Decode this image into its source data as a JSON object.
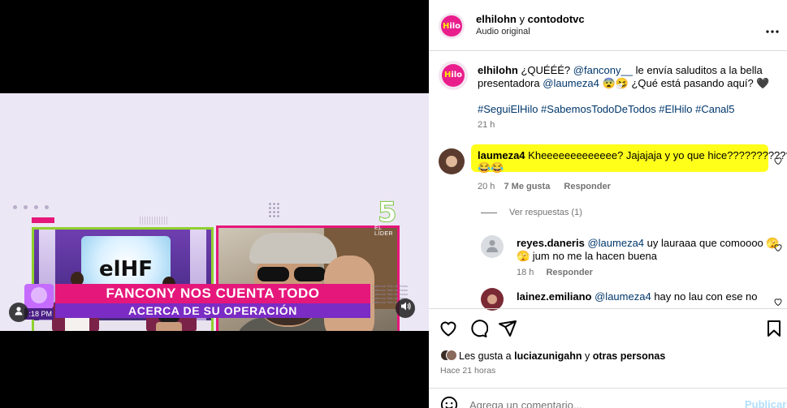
{
  "video": {
    "lower_third_line1": "FANCONY NOS CUENTA TODO",
    "lower_third_line2": "ACERCA DE SU OPERACIÓN",
    "time_label": ":18 PM",
    "channel_number": "5",
    "channel_sub": "EL LÍDER",
    "studio_logo_text": "elHF",
    "side_lines": [
      "Sabemos Todo de Todos",
      "Sabemos Todo de Todos",
      "Sabemos Todo de Todos",
      "Sabemos Todo de Todos",
      "Sabemos Todo de Todos"
    ]
  },
  "header": {
    "account": "elhilohn",
    "conj": "y",
    "collab": "contodotvc",
    "audio": "Audio original",
    "more_icon": "more-horizontal-icon"
  },
  "caption": {
    "username": "elhilohn",
    "text_a": "¿QUÉÉÉ?",
    "mention_1": "@fancony__",
    "text_b": "le envía saluditos a la bella",
    "text_c": "presentadora",
    "mention_2": "@laumeza4",
    "text_d": "😨🤧 ¿Qué está pasando aquí? 🖤",
    "hashtags": "#SeguiElHilo #SabemosTodoDeTodos #ElHilo #Canal5",
    "time": "21 h"
  },
  "comments": [
    {
      "username": "laumeza4",
      "text_line1": "Kheeeeeeeeeeeee? Jajajaja y yo que hice???????????",
      "text_line2": "😂😂",
      "time": "20 h",
      "likes": "7 Me gusta",
      "reply": "Responder",
      "view_replies": "Ver respuestas (1)"
    },
    {
      "username": "reyes.daneris",
      "mention": "@laumeza4",
      "text_line1": "uy lauraaa que comoooo 🫣",
      "text_line2": "🫣 jum no me la hacen buena",
      "time": "18 h",
      "reply": "Responder"
    },
    {
      "username": "lainez.emiliano",
      "mention": "@laumeza4",
      "text_line1": "hay no lau con ese no"
    }
  ],
  "actions": {
    "like_icon": "heart-icon",
    "comment_icon": "comment-icon",
    "share_icon": "send-icon",
    "save_icon": "bookmark-icon"
  },
  "likes_line": {
    "prefix": "Les gusta a",
    "user": "luciazunigahn",
    "suffix": "y",
    "others": "otras personas"
  },
  "posted": "Hace 21 horas",
  "add_comment": {
    "placeholder": "Agrega un comentario...",
    "publish": "Publicar"
  },
  "colors": {
    "pink": "#e6177b",
    "purple": "#7b2cc4",
    "green": "#8fd12e",
    "highlight": "#ffff1a",
    "link": "#00376b",
    "publish_disabled": "#b2dffc"
  }
}
